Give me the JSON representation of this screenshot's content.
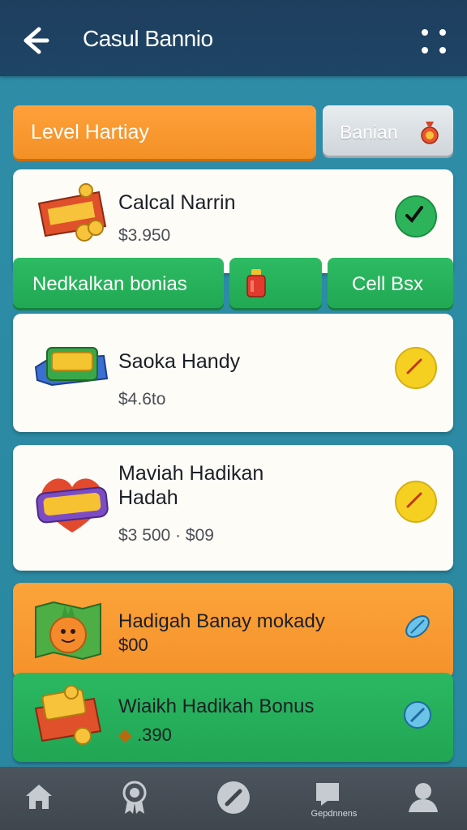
{
  "app_bar": {
    "title": "Casul Bannio",
    "back_icon": "arrow-left-icon",
    "menu_icon": "dots-grid-icon"
  },
  "tabs": {
    "level": "Level Hartiay",
    "banner": "Banian",
    "banner_icon": "money-bag-icon"
  },
  "items": [
    {
      "title": "Calcal Narrin",
      "price": "$3.950",
      "status": "checked",
      "status_color": "#2db45a"
    },
    {
      "title": "Saoka Handy",
      "price": "$4.6to",
      "status": "pending",
      "status_color": "#f5d020"
    },
    {
      "title": "Maviah Hadikan",
      "title_line2": "Hadah",
      "price": "$3 500 · $09",
      "status": "pending",
      "status_color": "#f5d020"
    }
  ],
  "actions": {
    "bonus": "Nedkalkan bonias",
    "sell": "Cell Bsx",
    "center_icon": "red-gift-bag-icon"
  },
  "promos": [
    {
      "title": "Hadigah Banay mokady",
      "price": "$00",
      "color": "#f79a2c"
    },
    {
      "title": "Wiaikh Hadikah Bonus",
      "price": ".390",
      "color": "#22ab58"
    }
  ],
  "bottom_nav": {
    "label_4": "Gepdnnens",
    "icons": [
      "home-icon",
      "award-badge-icon",
      "compass-icon",
      "chat-icon",
      "profile-icon"
    ]
  }
}
